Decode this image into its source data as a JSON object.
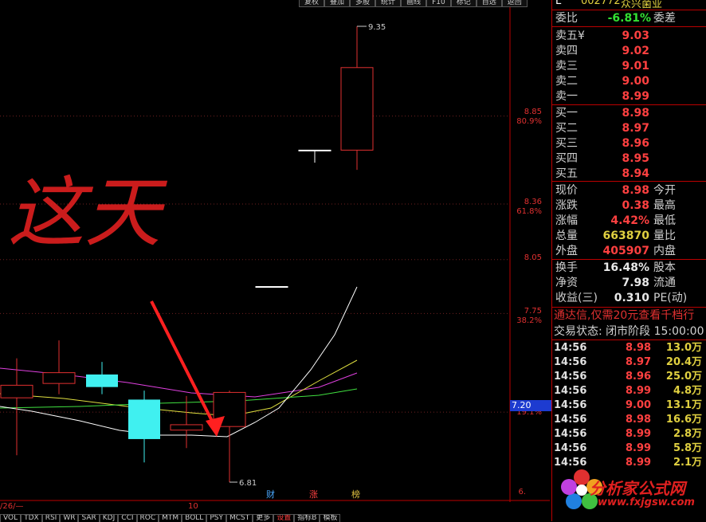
{
  "header": {
    "code": "002772",
    "name": "众兴菌业",
    "code_prefix": "L",
    "top_buttons": [
      "复权",
      "叠加",
      "多股",
      "统计",
      "画线",
      "F10",
      "标记",
      "自选",
      "返回"
    ]
  },
  "chart": {
    "price_labels": [
      "8.85",
      "8.36",
      "8.05",
      "7.75"
    ],
    "pct_labels": [
      "80.9%",
      "61.8%",
      "38.2%",
      "19.1%"
    ],
    "current_price_tag": "7.20",
    "high_annotation": "9.35",
    "low_annotation": "6.81",
    "bottom_price_label": "6.",
    "date_left": "/26/—",
    "date_mid": "10",
    "markers": [
      {
        "text": "财",
        "color": "#4aa8ff"
      },
      {
        "text": "涨",
        "color": "#ff4040"
      },
      {
        "text": "榜",
        "color": "#e0c040"
      }
    ],
    "handwriting": "这天",
    "candles": [
      {
        "open": 7.28,
        "close": 7.35,
        "high": 7.5,
        "low": 6.96,
        "color": "red"
      },
      {
        "open": 7.36,
        "close": 7.42,
        "high": 7.6,
        "low": 7.3,
        "color": "red"
      },
      {
        "open": 7.41,
        "close": 7.34,
        "high": 7.48,
        "low": 7.3,
        "color": "cyan"
      },
      {
        "open": 7.27,
        "close": 7.05,
        "high": 7.32,
        "low": 6.92,
        "color": "cyan"
      },
      {
        "open": 7.1,
        "close": 7.13,
        "high": 7.29,
        "low": 7.0,
        "color": "red"
      },
      {
        "open": 7.12,
        "close": 7.31,
        "high": 7.32,
        "low": 6.81,
        "color": "red"
      },
      {
        "open": 7.9,
        "close": 7.9,
        "high": 7.9,
        "low": 7.9,
        "color": "white"
      },
      {
        "open": 8.66,
        "close": 8.66,
        "high": 8.66,
        "low": 8.59,
        "color": "white"
      },
      {
        "open": 8.66,
        "close": 9.12,
        "high": 9.35,
        "low": 8.55,
        "color": "red"
      }
    ]
  },
  "bottom_tabs": [
    "VOL",
    "TDX",
    "RSI",
    "WR",
    "SAR",
    "KDJ",
    "CCI",
    "ROC",
    "MTM",
    "BOLL",
    "PSY",
    "MCST",
    "更多",
    "设置",
    "指标B",
    "模板"
  ],
  "bottom_tab_active": "设置",
  "quote": {
    "weibi_label": "委比",
    "weibi_value": "-6.81%",
    "weicha_label": "委差",
    "asks": [
      {
        "label": "卖五",
        "extra": "¥",
        "price": "9.03"
      },
      {
        "label": "卖四",
        "extra": "",
        "price": "9.02"
      },
      {
        "label": "卖三",
        "extra": "",
        "price": "9.01"
      },
      {
        "label": "卖二",
        "extra": "",
        "price": "9.00"
      },
      {
        "label": "卖一",
        "extra": "",
        "price": "8.99"
      }
    ],
    "bids": [
      {
        "label": "买一",
        "price": "8.98"
      },
      {
        "label": "买二",
        "price": "8.97"
      },
      {
        "label": "买三",
        "price": "8.96"
      },
      {
        "label": "买四",
        "price": "8.95"
      },
      {
        "label": "买五",
        "price": "8.94"
      }
    ],
    "stats": [
      {
        "label": "现价",
        "value": "8.98",
        "color": "red",
        "suffix": "今开"
      },
      {
        "label": "涨跌",
        "value": "0.38",
        "color": "red",
        "suffix": "最高"
      },
      {
        "label": "涨幅",
        "value": "4.42%",
        "color": "red",
        "suffix": "最低"
      },
      {
        "label": "总量",
        "value": "663870",
        "color": "yel",
        "suffix": "量比"
      },
      {
        "label": "外盘",
        "value": "405907",
        "color": "red",
        "suffix": "内盘"
      }
    ],
    "stats2": [
      {
        "label": "换手",
        "value": "16.48%",
        "color": "wht",
        "suffix": "股本"
      },
      {
        "label": "净资",
        "value": "7.98",
        "color": "wht",
        "suffix": "流通"
      },
      {
        "label": "收益(三)",
        "value": "0.310",
        "color": "wht",
        "suffix": "PE(动)"
      }
    ],
    "promo": "通达信,仅需20元查看千档行",
    "trade_status": "交易状态: 闭市阶段 15:00:00"
  },
  "ticks": [
    {
      "time": "14:56",
      "price": "8.98",
      "vol": "13.0万"
    },
    {
      "time": "14:56",
      "price": "8.97",
      "vol": "20.4万"
    },
    {
      "time": "14:56",
      "price": "8.96",
      "vol": "25.0万"
    },
    {
      "time": "14:56",
      "price": "8.99",
      "vol": "4.8万"
    },
    {
      "time": "14:56",
      "price": "9.00",
      "vol": "13.1万"
    },
    {
      "time": "14:56",
      "price": "8.98",
      "vol": "16.6万"
    },
    {
      "time": "14:56",
      "price": "8.99",
      "vol": "2.8万"
    },
    {
      "time": "14:56",
      "price": "8.99",
      "vol": "5.8万"
    },
    {
      "time": "14:56",
      "price": "8.99",
      "vol": "2.1万"
    }
  ],
  "watermark": {
    "title": "分析家公式网",
    "url": "www.fxjgsw.com"
  },
  "colors": {
    "up": "#e03030",
    "down": "#40f0f0",
    "ma1": "#ffffff",
    "ma2": "#e0e040",
    "ma3": "#e040e0",
    "ma4": "#40e040",
    "arrow": "#ff2020"
  }
}
